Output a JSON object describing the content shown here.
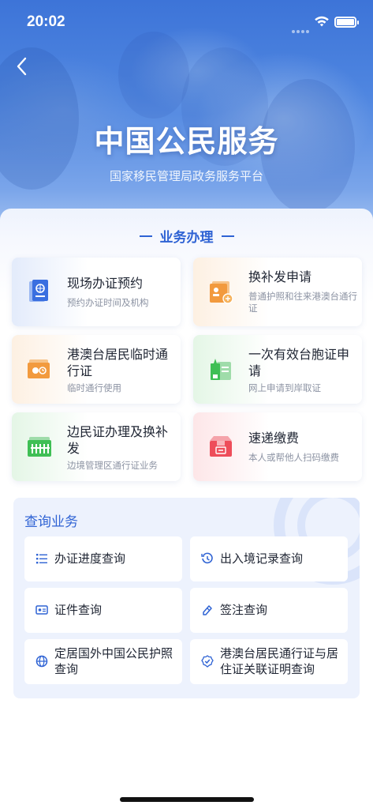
{
  "status_bar": {
    "time": "20:02"
  },
  "hero": {
    "title": "中国公民服务",
    "subtitle": "国家移民管理局政务服务平台"
  },
  "business": {
    "section_title": "业务办理",
    "cards": [
      {
        "title": "现场办证预约",
        "desc": "预约办证时间及机构",
        "icon": "passport-icon",
        "color": "#3a6fe0"
      },
      {
        "title": "换补发申请",
        "desc": "普通护照和往来港澳台通行证",
        "icon": "id-card-icon",
        "color": "#f29a3e"
      },
      {
        "title": "港澳台居民临时通行证",
        "desc": "临时通行使用",
        "icon": "temp-pass-icon",
        "color": "#f29a3e"
      },
      {
        "title": "一次有效台胞证申请",
        "desc": "网上申请到岸取证",
        "icon": "taiwan-permit-icon",
        "color": "#3fbf55"
      },
      {
        "title": "边民证办理及换补发",
        "desc": "边境管理区通行证业务",
        "icon": "border-pass-icon",
        "color": "#3fbf55"
      },
      {
        "title": "速递缴费",
        "desc": "本人或帮他人扫码缴费",
        "icon": "express-box-icon",
        "color": "#ee4d5a"
      }
    ]
  },
  "query": {
    "section_title": "查询业务",
    "items": [
      {
        "label": "办证进度查询",
        "icon": "progress-list-icon"
      },
      {
        "label": "出入境记录查询",
        "icon": "history-clock-icon"
      },
      {
        "label": "证件查询",
        "icon": "certificate-icon"
      },
      {
        "label": "签注查询",
        "icon": "endorsement-icon"
      },
      {
        "label": "定居国外中国公民护照查询",
        "icon": "globe-icon"
      },
      {
        "label": "港澳台居民通行证与居住证关联证明查询",
        "icon": "verified-badge-icon"
      }
    ]
  },
  "colors": {
    "accent": "#2f63d4",
    "hero_bg": "#4f86e0"
  }
}
